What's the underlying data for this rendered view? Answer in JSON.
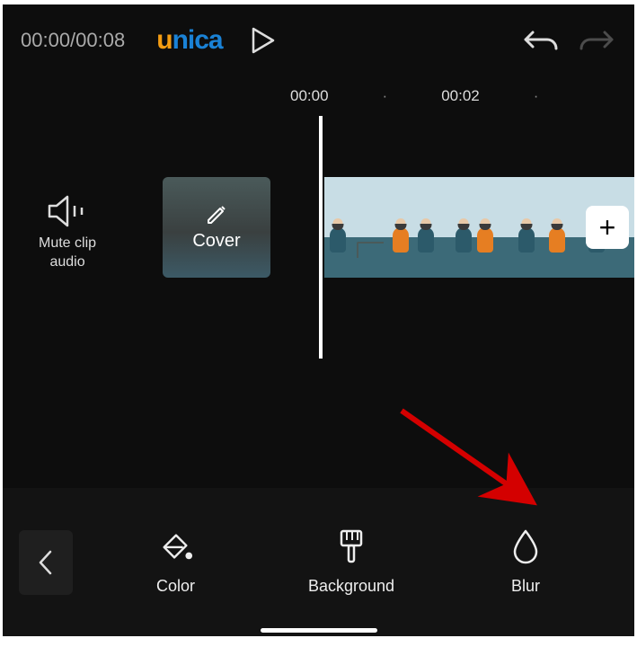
{
  "header": {
    "timecode": "00:00/00:08",
    "brand_u": "u",
    "brand_n": "n",
    "brand_i": "i",
    "brand_c": "c",
    "brand_a": "a"
  },
  "ruler": {
    "zero": "00:00",
    "dot": "·",
    "two": "00:02"
  },
  "mute": {
    "line1": "Mute clip",
    "line2": "audio"
  },
  "cover": {
    "label": "Cover"
  },
  "add_clip": {
    "symbol": "+"
  },
  "toolbar": {
    "color": "Color",
    "background": "Background",
    "blur": "Blur"
  }
}
